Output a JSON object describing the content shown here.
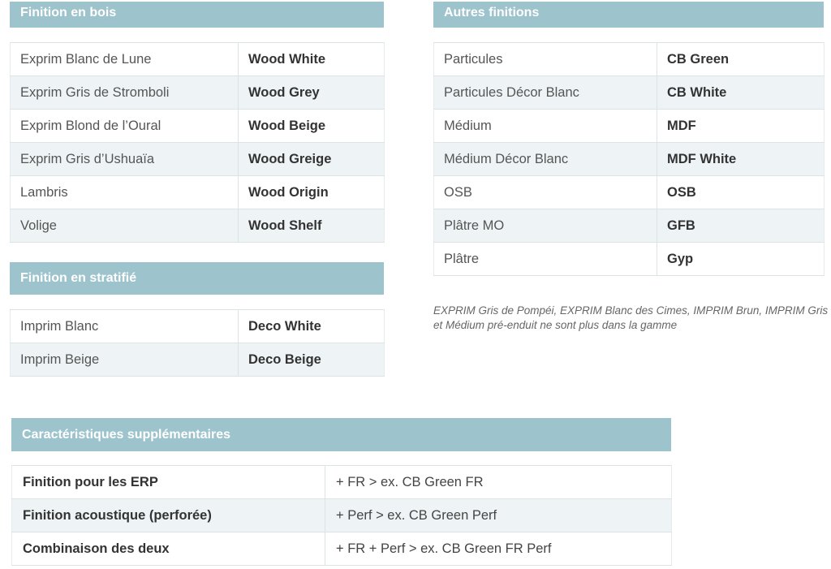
{
  "wood": {
    "title": "Finition en bois",
    "rows": [
      {
        "name": "Exprim Blanc de Lune",
        "code": "Wood White"
      },
      {
        "name": "Exprim Gris de Stromboli",
        "code": "Wood Grey"
      },
      {
        "name": "Exprim Blond de l’Oural",
        "code": "Wood Beige"
      },
      {
        "name": "Exprim Gris d’Ushuaïa",
        "code": "Wood Greige"
      },
      {
        "name": "Lambris",
        "code": "Wood Origin"
      },
      {
        "name": "Volige",
        "code": "Wood Shelf"
      }
    ]
  },
  "laminate": {
    "title": "Finition en stratifié",
    "rows": [
      {
        "name": "Imprim Blanc",
        "code": "Deco White"
      },
      {
        "name": "Imprim Beige",
        "code": "Deco Beige"
      }
    ]
  },
  "other": {
    "title": "Autres finitions",
    "rows": [
      {
        "name": "Particules",
        "code": "CB Green"
      },
      {
        "name": "Particules Décor Blanc",
        "code": "CB White"
      },
      {
        "name": "Médium",
        "code": "MDF"
      },
      {
        "name": "Médium Décor Blanc",
        "code": "MDF White"
      },
      {
        "name": "OSB",
        "code": "OSB"
      },
      {
        "name": "Plâtre MO",
        "code": "GFB"
      },
      {
        "name": "Plâtre",
        "code": "Gyp"
      }
    ]
  },
  "note": "EXPRIM Gris de Pompéi, EXPRIM Blanc des Cimes, IMPRIM Brun, IMPRIM Gris et Médium pré-enduit ne sont plus dans la gamme",
  "extra": {
    "title": "Caractéristiques supplémentaires",
    "rows": [
      {
        "name": "Finition pour les ERP",
        "code": "+ FR > ex. CB Green FR"
      },
      {
        "name": "Finition acoustique (perforée)",
        "code": "+ Perf > ex. CB Green Perf"
      },
      {
        "name": "Combinaison des deux",
        "code": "+ FR + Perf > ex. CB Green FR Perf"
      }
    ]
  },
  "colors": {
    "header": "#9dc3cc",
    "row_alt": "#eef4f6"
  }
}
